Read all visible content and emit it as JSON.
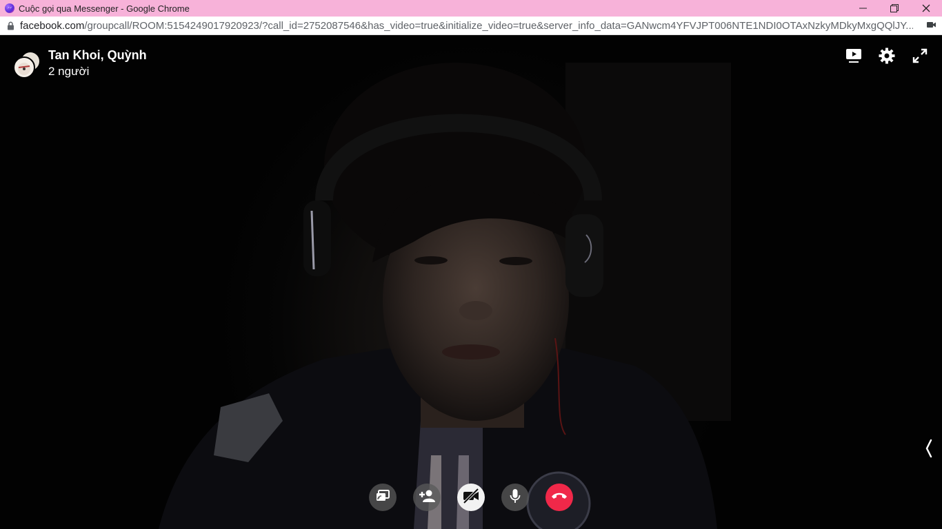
{
  "window": {
    "title": "Cuộc gọi qua Messenger - Google Chrome",
    "controls": {
      "minimize": "—",
      "restore": "❐",
      "close": "✕"
    }
  },
  "address_bar": {
    "host": "facebook.com",
    "path": "/groupcall/ROOM:5154249017920923/?call_id=2752087546&has_video=true&initialize_video=true&server_info_data=GANwcm4YFVJPT006NTE1NDI0OTAxNzkyMDkyMxgQQlJY..."
  },
  "call": {
    "participants_title": "Tan Khoi, Quỳnh",
    "participant_count": "2 người"
  },
  "icons": {
    "messenger": "messenger-icon",
    "lock": "lock-icon",
    "camera_address": "video-camera-icon",
    "watch_together": "play-video-icon",
    "settings": "gear-icon",
    "fullscreen": "expand-icon",
    "side_panel": "chevron-left-icon",
    "share_screen": "share-screen-icon",
    "add_person": "add-person-icon",
    "camera_off": "video-off-icon",
    "microphone": "microphone-icon",
    "end_call": "hang-up-icon"
  },
  "colors": {
    "titlebar": "#f7b2d9",
    "end_call": "#f02849",
    "video_bg": "#000000"
  }
}
